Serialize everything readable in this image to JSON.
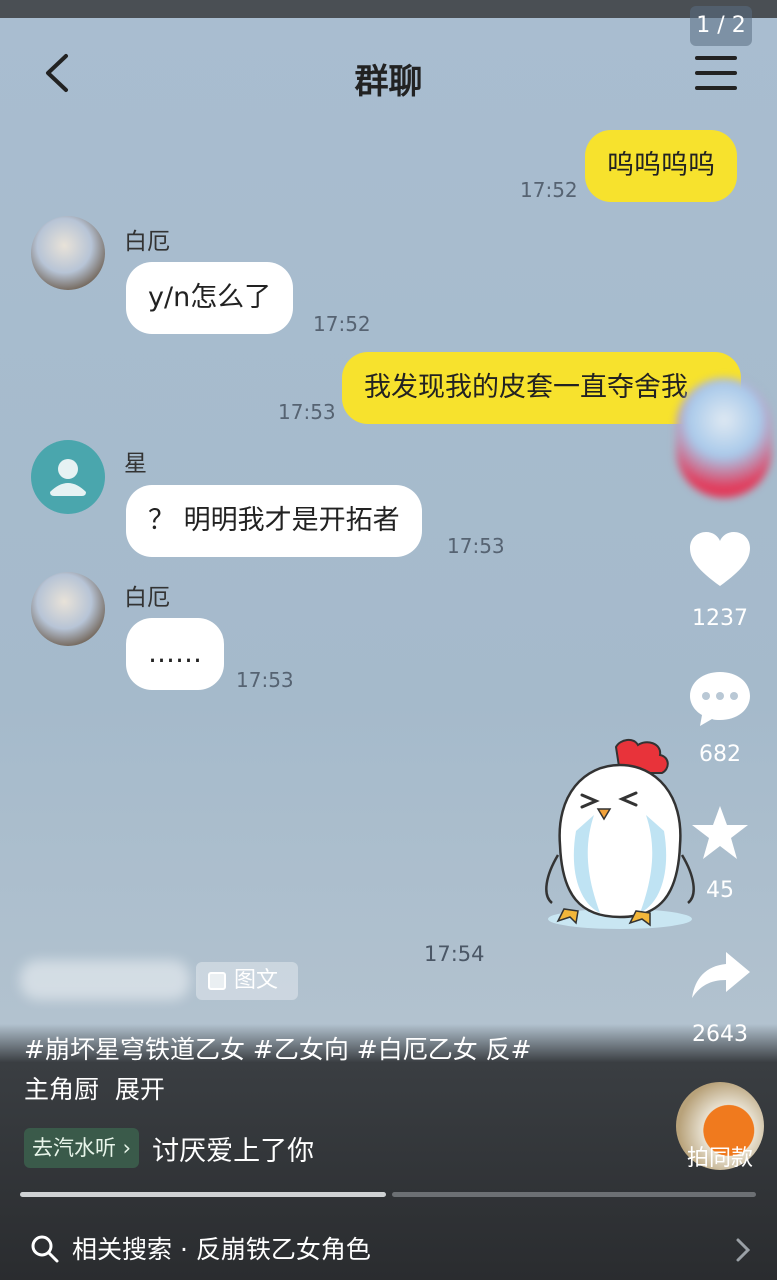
{
  "page_indicator": "1 / 2",
  "header": {
    "title": "群聊"
  },
  "messages": [
    {
      "text": "呜呜呜呜",
      "time": "17:52"
    },
    {
      "sender": "白厄",
      "text": "y/n怎么了",
      "time": "17:52"
    },
    {
      "text": "我发现我的皮套一直夺舍我",
      "time": "17:53"
    },
    {
      "sender": "星",
      "text": "？ 明明我才是开拓者",
      "time": "17:53"
    },
    {
      "sender": "白厄",
      "text": "……",
      "time": "17:53"
    }
  ],
  "last_time": "17:54",
  "actions": {
    "likes": "1237",
    "comments": "682",
    "favorites": "45",
    "shares": "2643"
  },
  "post": {
    "type_tag": "图文",
    "hashtags": "#崩坏星穹铁道乙女 #乙女向 #白厄乙女 反#",
    "hashtags_line2": "主角厨",
    "expand": "展开",
    "music_button": "去汽水听 ›",
    "music_title": "讨厌爱上了你",
    "same_style": "拍同款"
  },
  "search": {
    "text": "相关搜索 · 反崩铁乙女角色"
  },
  "colors": {
    "my_bubble": "#f7e22d",
    "their_bubble": "#ffffff",
    "background": "#a9bdd0"
  }
}
